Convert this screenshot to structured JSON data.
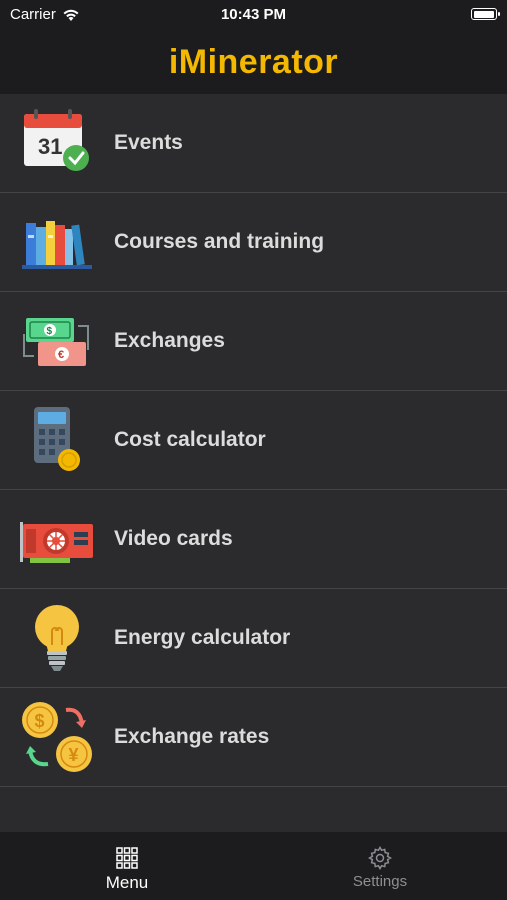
{
  "status": {
    "carrier": "Carrier",
    "time": "10:43 PM",
    "battery_level": 1.0
  },
  "nav": {
    "title": "iMinerator"
  },
  "menu": {
    "items": [
      {
        "label": "Events",
        "icon": "calendar-check-icon"
      },
      {
        "label": "Courses and training",
        "icon": "books-icon"
      },
      {
        "label": "Exchanges",
        "icon": "money-exchange-icon"
      },
      {
        "label": "Cost calculator",
        "icon": "calculator-coin-icon"
      },
      {
        "label": "Video cards",
        "icon": "graphics-card-icon"
      },
      {
        "label": "Energy calculator",
        "icon": "light-bulb-icon"
      },
      {
        "label": "Exchange rates",
        "icon": "currency-exchange-icon"
      }
    ]
  },
  "tabbar": {
    "tabs": [
      {
        "label": "Menu",
        "icon": "grid-icon",
        "active": true
      },
      {
        "label": "Settings",
        "icon": "gear-icon",
        "active": false
      }
    ]
  },
  "colors": {
    "accent": "#f5b800",
    "background": "#2b2b2d",
    "bars": "#1c1c1e"
  }
}
